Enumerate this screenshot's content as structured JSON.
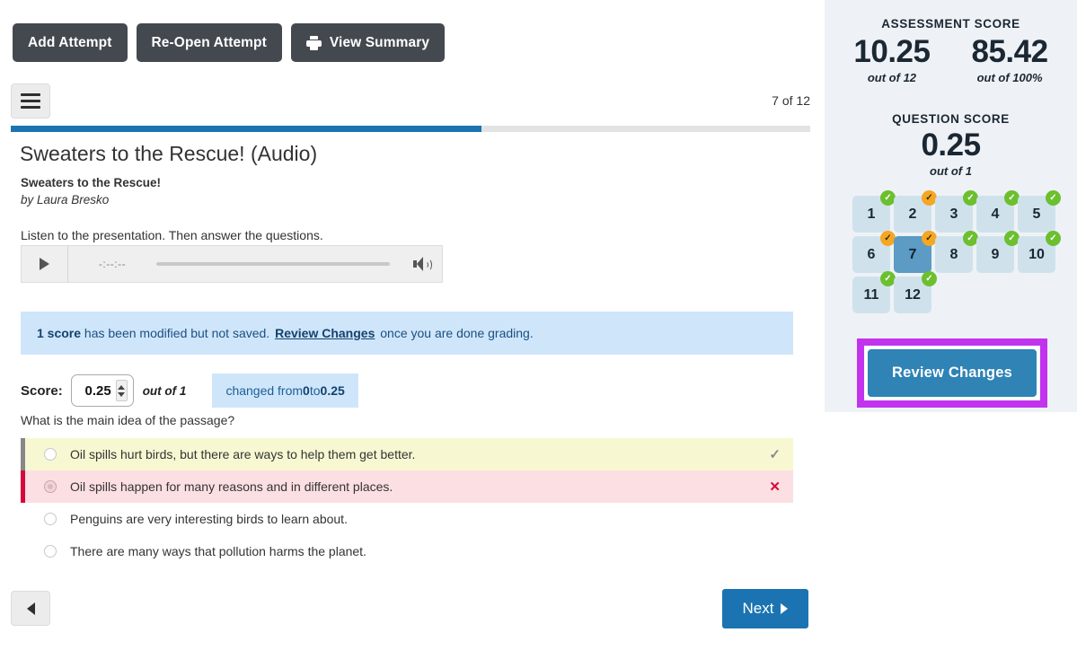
{
  "toolbar": {
    "add_attempt_label": "Add Attempt",
    "reopen_attempt_label": "Re-Open Attempt",
    "view_summary_label": "View Summary"
  },
  "nav": {
    "question_counter": "7 of 12",
    "progress_percent": 58.9,
    "next_label": "Next"
  },
  "passage": {
    "title": "Sweaters to the Rescue! (Audio)",
    "subtitle": "Sweaters to the Rescue!",
    "byline": "by Laura Bresko",
    "instructions": "Listen to the presentation. Then answer the questions."
  },
  "audio": {
    "time_display": "-:--:--"
  },
  "alert": {
    "lead": "1 score",
    "text_before_link": " has been modified but not saved. ",
    "link_label": "Review Changes",
    "text_after_link": " once you are done grading."
  },
  "score": {
    "label": "Score:",
    "value": "0.25",
    "out_of": "out of 1",
    "changed_prefix": "changed from ",
    "changed_from": "0",
    "changed_middle": " to ",
    "changed_to": "0.25"
  },
  "question": {
    "prompt": "What is the main idea of the passage?",
    "options": [
      {
        "text": "Oil spills hurt birds, but there are ways to help them get better.",
        "state": "correct",
        "mark": "✓",
        "selected": false
      },
      {
        "text": "Oil spills happen for many reasons and in different places.",
        "state": "incorrect",
        "mark": "✕",
        "selected": true
      },
      {
        "text": "Penguins are very interesting birds to learn about.",
        "state": "plain",
        "mark": "",
        "selected": false
      },
      {
        "text": "There are many ways that pollution harms the planet.",
        "state": "plain",
        "mark": "",
        "selected": false
      }
    ]
  },
  "sidebar": {
    "assessment_heading": "ASSESSMENT SCORE",
    "assessment_points": "10.25",
    "assessment_points_sub": "out of 12",
    "assessment_percent": "85.42",
    "assessment_percent_sub": "out of 100%",
    "question_heading": "QUESTION SCORE",
    "question_score": "0.25",
    "question_score_sub": "out of 1",
    "review_changes_label": "Review Changes",
    "questions": [
      {
        "number": "1",
        "badge": "full",
        "active": false
      },
      {
        "number": "2",
        "badge": "partial",
        "active": false
      },
      {
        "number": "3",
        "badge": "full",
        "active": false
      },
      {
        "number": "4",
        "badge": "full",
        "active": false
      },
      {
        "number": "5",
        "badge": "full",
        "active": false
      },
      {
        "number": "6",
        "badge": "partial",
        "active": false
      },
      {
        "number": "7",
        "badge": "partial",
        "active": true
      },
      {
        "number": "8",
        "badge": "full",
        "active": false
      },
      {
        "number": "9",
        "badge": "full",
        "active": false
      },
      {
        "number": "10",
        "badge": "full",
        "active": false
      },
      {
        "number": "11",
        "badge": "full",
        "active": false
      },
      {
        "number": "12",
        "badge": "full",
        "active": false
      }
    ]
  },
  "colors": {
    "accent_blue": "#1b74b1",
    "dark_button": "#444950",
    "sidebar_bg": "#eef2f6",
    "tile_idle": "#cfe2ec",
    "tile_active": "#5b9bc4",
    "badge_full": "#6cbf2e",
    "badge_partial": "#f5a623",
    "correct_bg": "#f7f8d2",
    "incorrect_bg": "#fbdfe3",
    "incorrect_border": "#d6083b",
    "alert_bg": "#cfe6fa",
    "highlight_ring": "#c233ee"
  }
}
